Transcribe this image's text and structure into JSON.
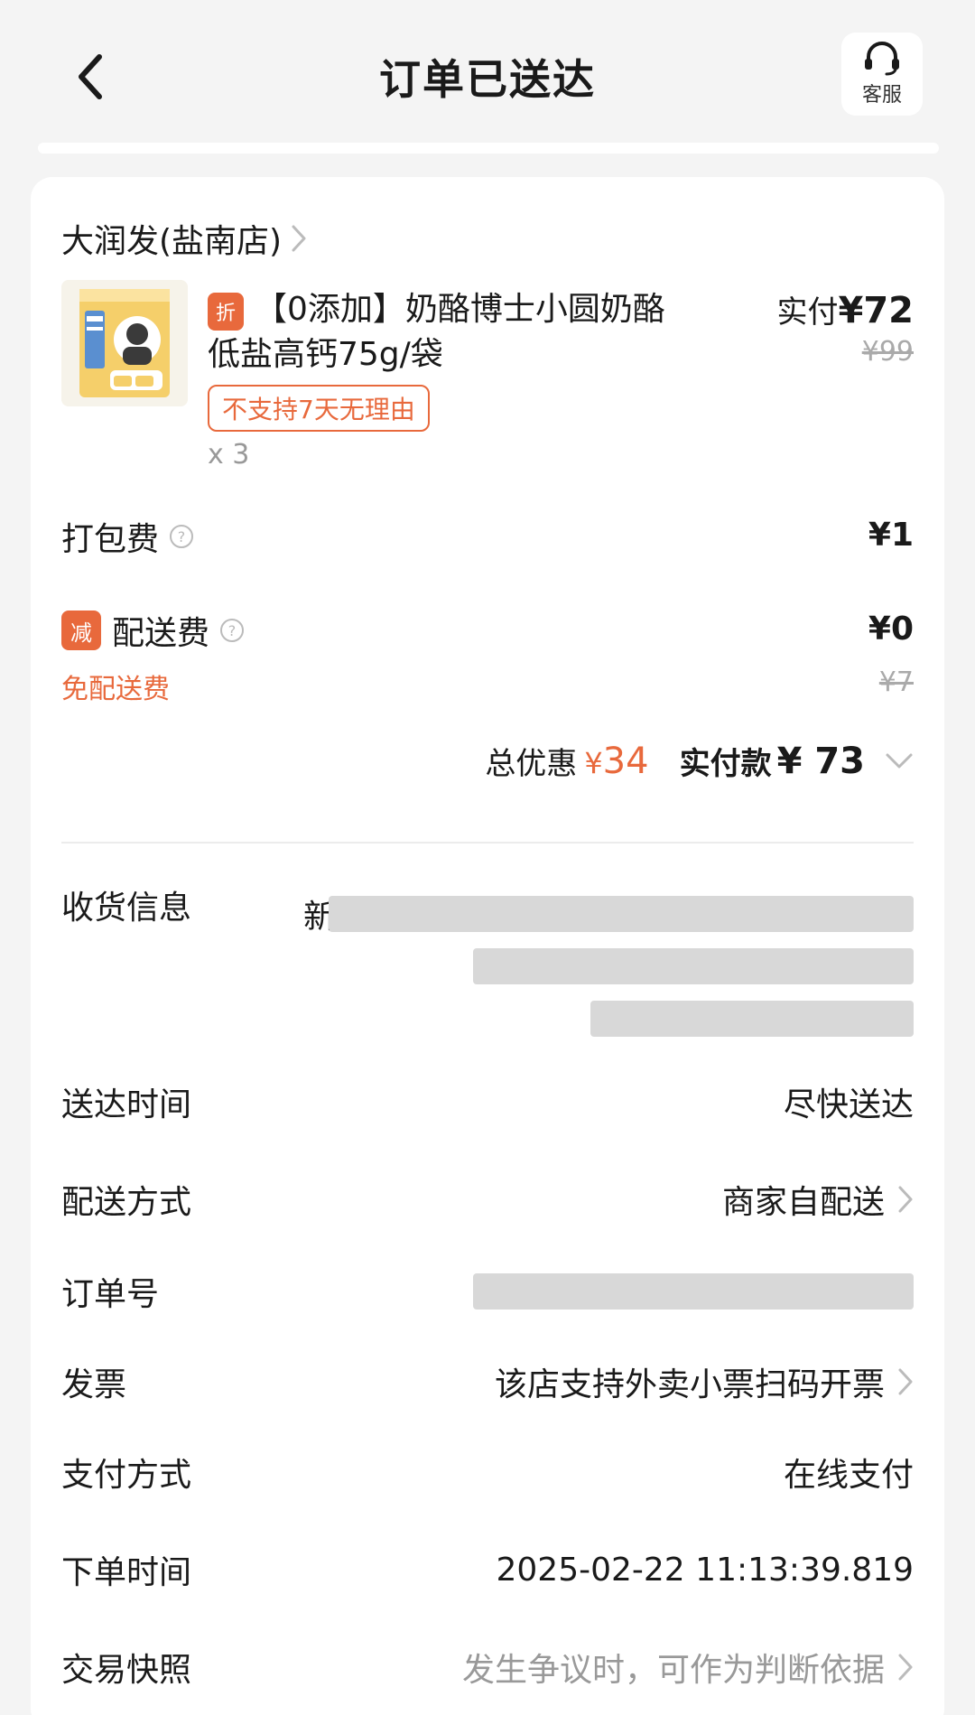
{
  "header": {
    "title": "订单已送达",
    "customer_service_label": "客服"
  },
  "store": {
    "name": "大润发(盐南店)"
  },
  "product": {
    "discount_tag": "折",
    "name": "【0添加】奶酪博士小圆奶酪低盐高钙75g/袋",
    "paid_label": "实付",
    "paid_price": "¥72",
    "original_price": "¥99",
    "return_policy_tag": "不支持7天无理由",
    "quantity": "x 3"
  },
  "fees": {
    "packing_label": "打包费",
    "packing_value": "¥1",
    "delivery_reduce_tag": "减",
    "delivery_label": "配送费",
    "delivery_value": "¥0",
    "delivery_original": "¥7",
    "free_delivery_text": "免配送费"
  },
  "totals": {
    "discount_label": "总优惠",
    "discount_currency": "¥",
    "discount_value": "34",
    "paid_label": "实付款",
    "paid_value": "¥ 73"
  },
  "info": {
    "address_label": "收货信息",
    "address_first_char": "新",
    "delivery_time_label": "送达时间",
    "delivery_time_value": "尽快送达",
    "delivery_method_label": "配送方式",
    "delivery_method_value": "商家自配送",
    "order_no_label": "订单号",
    "invoice_label": "发票",
    "invoice_value": "该店支持外卖小票扫码开票",
    "payment_label": "支付方式",
    "payment_value": "在线支付",
    "order_time_label": "下单时间",
    "order_time_value": "2025-02-22 11:13:39.819",
    "snapshot_label": "交易快照",
    "snapshot_value": "发生争议时，可作为判断依据"
  },
  "icons": {
    "back": "chevron-left-icon",
    "customer_service": "headset-icon",
    "store_arrow": "chevron-right-icon",
    "help": "question-circle-icon",
    "expand": "chevron-down-icon"
  },
  "colors": {
    "accent": "#e8693c",
    "muted": "#999999",
    "strikethrough": "#aaaaaa"
  }
}
